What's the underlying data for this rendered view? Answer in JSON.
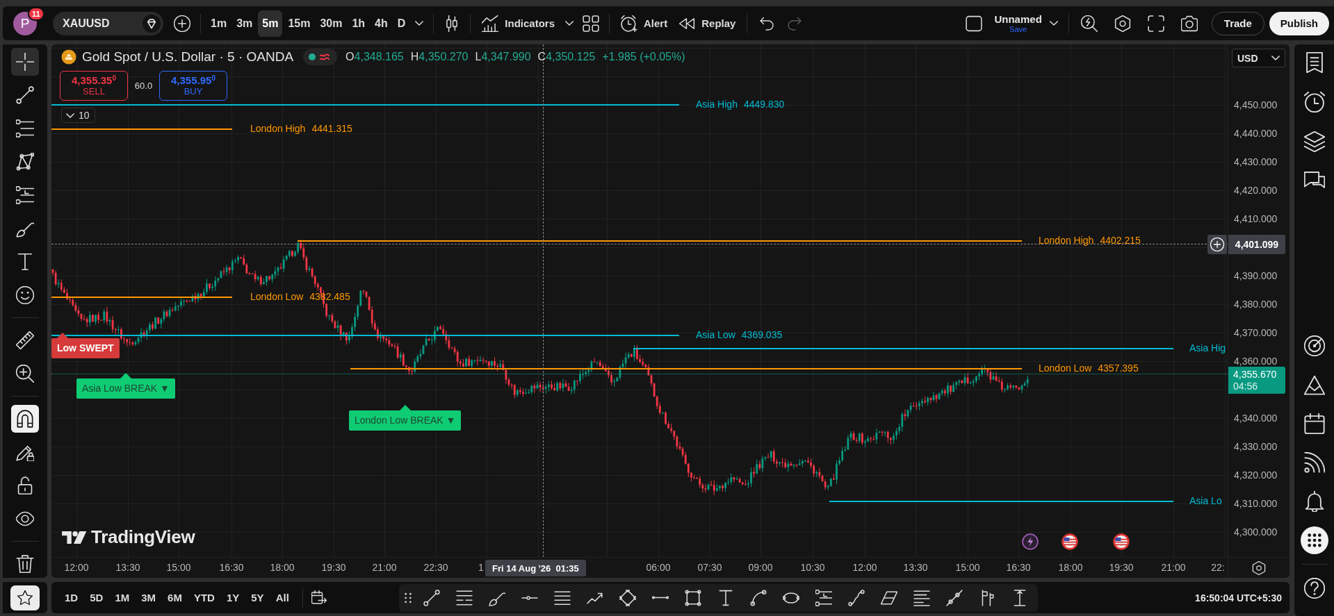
{
  "top_bar": {
    "avatar": {
      "initial": "P",
      "badge": "11"
    },
    "symbol": "XAUUSD",
    "intervals": [
      {
        "label": "1m",
        "selected": false
      },
      {
        "label": "3m",
        "selected": false
      },
      {
        "label": "5m",
        "selected": true
      },
      {
        "label": "15m",
        "selected": false
      },
      {
        "label": "30m",
        "selected": false
      },
      {
        "label": "1h",
        "selected": false
      },
      {
        "label": "4h",
        "selected": false
      },
      {
        "label": "D",
        "selected": false
      }
    ],
    "indicators": "Indicators",
    "alert": "Alert",
    "replay": "Replay",
    "history": [
      {
        "disabled": false
      },
      {
        "disabled": true
      }
    ],
    "layout": {
      "name": "Unnamed",
      "save": "Save"
    },
    "trade": "Trade",
    "publish": "Publish"
  },
  "left_toolbar": {
    "tools": [
      {
        "selected": true
      },
      {
        "selected": false
      },
      {
        "selected": false
      },
      {
        "selected": false
      },
      {
        "selected": false
      },
      {
        "selected": false
      },
      {
        "selected": false
      },
      {
        "selected": false
      },
      {
        "selected": false
      },
      {
        "selected": false
      }
    ],
    "toggles": [
      {
        "on": true
      },
      {
        "on": false
      },
      {
        "on": false
      },
      {
        "on": false
      }
    ]
  },
  "chart": {
    "legend": {
      "title": "Gold Spot / U.S. Dollar · 5 · OANDA",
      "ohlc": [
        {
          "key": "O",
          "value": "4,348.165"
        },
        {
          "key": "H",
          "value": "4,350.270"
        },
        {
          "key": "L",
          "value": "4,347.990"
        },
        {
          "key": "C",
          "value": "4,350.125"
        }
      ],
      "change": "+1.985 (+0.05%)"
    },
    "trade_panel": {
      "sell_price": "4,355.35$^{0}$",
      "sell_label": "SELL",
      "spread": "60.0",
      "buy_price": "4,355.95$^{0}$",
      "buy_label": "BUY"
    },
    "collapse": "10",
    "levels": [
      {
        "label": "Asia High",
        "value": "4449.830",
        "color": "#00bcd4"
      },
      {
        "label": "London High",
        "value": "4441.315",
        "color": "#ff9800"
      },
      {
        "label": "London High",
        "value": "4402.215",
        "color": "#ff9800"
      },
      {
        "label": "London Low",
        "value": "4382.485",
        "color": "#ff9800"
      },
      {
        "label": "Asia Low",
        "value": "4369.035",
        "color": "#00bcd4"
      },
      {
        "label": "Asia Hig",
        "color": "#00bcd4"
      },
      {
        "label": "London Low",
        "value": "4357.395",
        "color": "#ff9800"
      },
      {
        "label": "Asia Lo",
        "color": "#00bcd4"
      }
    ],
    "signals": [
      {
        "kind": "sweep",
        "text": "Low SWEPT"
      },
      {
        "kind": "break",
        "text": "Asia Low BREAK ▼"
      },
      {
        "kind": "break",
        "text": "London Low BREAK ▼"
      }
    ],
    "logo": "TradingView"
  },
  "price_axis": {
    "currency": "USD",
    "ticks": [
      "4,450.000",
      "4,440.000",
      "4,430.000",
      "4,420.000",
      "4,410.000",
      "4,390.000",
      "4,380.000",
      "4,370.000",
      "4,360.000",
      "4,340.000",
      "4,330.000",
      "4,320.000",
      "4,310.000",
      "4,300.000"
    ],
    "crosshair_price": "4,401.099",
    "last_price": "4,355.670",
    "countdown": "04:56"
  },
  "time_axis": {
    "labels": [
      "12:00",
      "13:30",
      "15:00",
      "16:30",
      "18:00",
      "19:30",
      "21:00",
      "22:30",
      "1",
      "06:00",
      "07:30",
      "09:00",
      "10:30",
      "12:00",
      "13:30",
      "15:00",
      "16:30",
      "18:00",
      "19:30",
      "21:00",
      "22:"
    ],
    "crosshair_time": "Fri 14 Aug '26  01:35"
  },
  "bottom_bar": {
    "ranges": [
      "1D",
      "5D",
      "1M",
      "3M",
      "6M",
      "YTD",
      "1Y",
      "5Y",
      "All"
    ],
    "clock": "16:50:04 UTC+5:30"
  }
}
